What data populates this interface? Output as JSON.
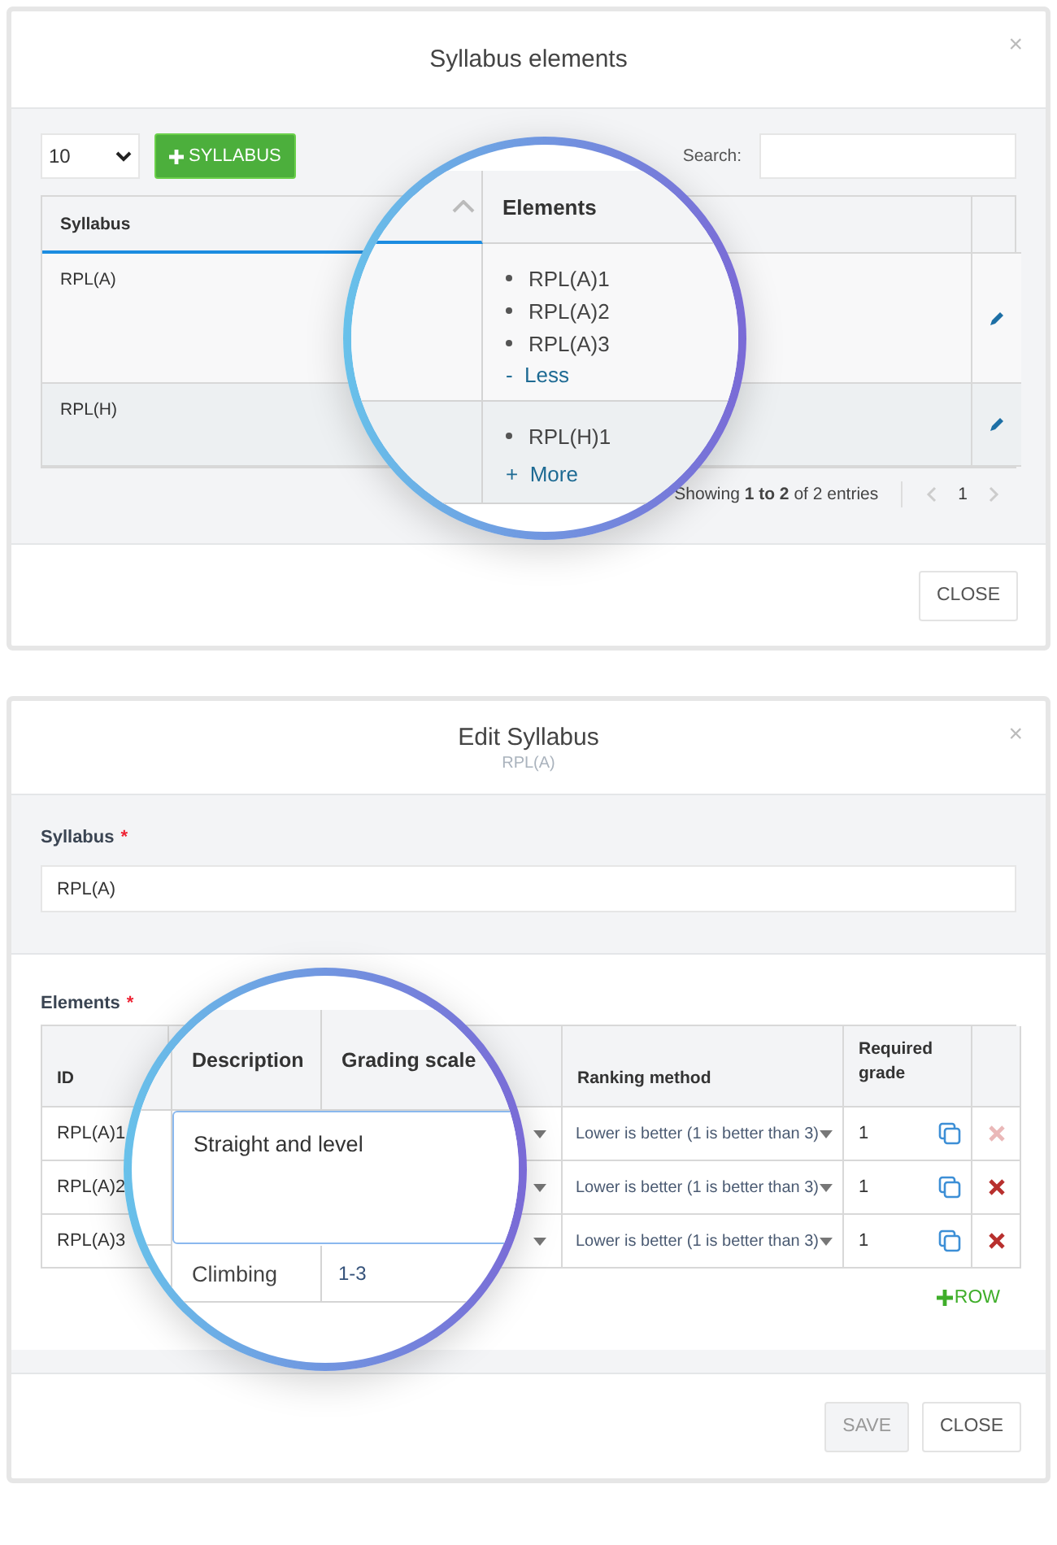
{
  "syllabus_modal": {
    "title": "Syllabus elements",
    "close": "×",
    "page_length": "10",
    "add_button": "SYLLABUS",
    "search_label": "Search:",
    "columns": [
      {
        "label": "Syllabus",
        "sorted": true
      }
    ],
    "rows": [
      {
        "syllabus": "RPL(A)"
      },
      {
        "syllabus": "RPL(H)"
      }
    ],
    "info": "Showing **1 to 2** of 2 entries",
    "page": "1",
    "footer_button": "CLOSE",
    "magnifier": {
      "header": "Elements",
      "rows": [
        {
          "items": [
            "RPL(A)1",
            "RPL(A)2",
            "RPL(A)3"
          ],
          "toggle_sign": "-",
          "toggle": "Less"
        },
        {
          "items": [
            "RPL(H)1"
          ],
          "toggle_sign": "+",
          "toggle": "More"
        }
      ]
    }
  },
  "edit_modal": {
    "title": "Edit Syllabus",
    "subtitle": "RPL(A)",
    "close": "×",
    "syllabus_field": {
      "label": "Syllabus",
      "required_mark": "*",
      "value": "RPL(A)"
    },
    "elements_label": "Elements",
    "elements_required_mark": "*",
    "columns": [
      "ID",
      "Ranking method",
      "Required grade"
    ],
    "rows": [
      {
        "id": "RPL(A)1",
        "ranking": "Lower is better (1 is better than 3)",
        "required_grade": "1",
        "delete_disabled": true
      },
      {
        "id": "RPL(A)2",
        "ranking": "Lower is better (1 is better than 3)",
        "required_grade": "1",
        "delete_disabled": false
      },
      {
        "id": "RPL(A)3",
        "ranking": "Lower is better (1 is better than 3)",
        "required_grade": "1",
        "delete_disabled": false
      }
    ],
    "add_row": "ROW",
    "magnifier": {
      "headers": [
        "Description",
        "Grading scale"
      ],
      "editing_value": "Straight and level",
      "rows": [
        {
          "description": "Climbing",
          "grading_scale": "1-3"
        }
      ]
    },
    "buttons": [
      {
        "label": "SAVE",
        "disabled": true
      },
      {
        "label": "CLOSE",
        "disabled": false
      }
    ]
  }
}
